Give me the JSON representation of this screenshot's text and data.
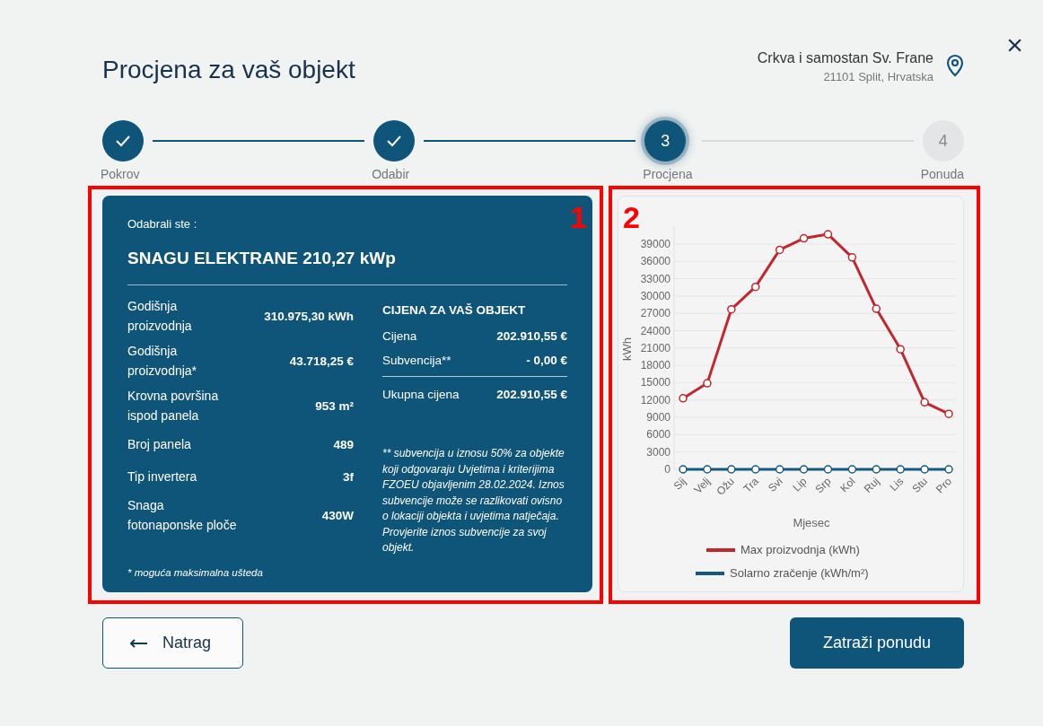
{
  "header": {
    "title": "Procjena za vaš objekt",
    "location_name": "Crkva i samostan Sv. Frane",
    "location_address": "21101 Split, Hrvatska",
    "close": "×"
  },
  "steps": [
    {
      "label": "Pokrov",
      "completed": true,
      "selected": false
    },
    {
      "label": "Odabir",
      "completed": true,
      "selected": false
    },
    {
      "label": "Procjena",
      "number": "3",
      "completed": false,
      "selected": true
    },
    {
      "label": "Ponuda",
      "number": "4",
      "completed": false,
      "selected": false
    }
  ],
  "summary": {
    "intro": "Odabrali ste :",
    "headline": "SNAGU ELEKTRANE 210,27 kWp",
    "specs": [
      {
        "label": "Godišnja proizvodnja",
        "value": "310.975,30 kWh"
      },
      {
        "label": "Godišnja proizvodnja*",
        "value": "43.718,25 €"
      },
      {
        "label": "Krovna površina ispod panela",
        "value": "953 m²"
      },
      {
        "label": "Broj panela",
        "value": "489"
      },
      {
        "label": "Tip invertera",
        "value": "3f"
      },
      {
        "label": "Snaga fotonaponske ploče",
        "value": "430W"
      }
    ],
    "footnote": "* moguća maksimalna ušteda",
    "price": {
      "title": "CIJENA ZA VAŠ OBJEKT",
      "rows": [
        {
          "kind": "item",
          "label": "Cijena",
          "value": "202.910,55 €"
        },
        {
          "kind": "item",
          "label": "Subvencija**",
          "value": "- 0,00 €"
        },
        {
          "kind": "total",
          "label": "Ukupna cijena",
          "value": "202.910,55 €"
        }
      ],
      "note": "** subvencija u iznosu 50% za objekte koji odgovaraju Uvjetima i kriterijima FZOEU objavljenim 28.02.2024. Iznos subvencije može se razlikovati ovisno o lokaciji objekta i uvjetima natječaja. Provjerite iznos subvencije za svoj objekt."
    }
  },
  "chart_data": {
    "type": "line",
    "xlabel": "Mjesec",
    "ylabel": "kWh",
    "categories": [
      "Sij",
      "Velj",
      "Ožu",
      "Tra",
      "Svi",
      "Lip",
      "Srp",
      "Kol",
      "Ruj",
      "Lis",
      "Stu",
      "Pro"
    ],
    "ylim": [
      0,
      42000
    ],
    "grid": true,
    "legend": true,
    "series": [
      {
        "name": "Max proizvodnja (kWh)",
        "color": "#c0282d",
        "marker": "circle",
        "values": [
          12300,
          14900,
          27700,
          31600,
          38000,
          40000,
          40700,
          36700,
          27800,
          20800,
          11600,
          9600
        ]
      },
      {
        "name": "Solarno zračenje (kWh/m²)",
        "color": "#145a80",
        "marker": "circle",
        "values": [
          0,
          0,
          0,
          0,
          0,
          0,
          0,
          0,
          0,
          0,
          0,
          0
        ]
      }
    ],
    "yticks": [
      0,
      3000,
      6000,
      9000,
      12000,
      15000,
      18000,
      21000,
      24000,
      27000,
      30000,
      33000,
      36000,
      39000
    ]
  },
  "annotations": [
    {
      "label": "1"
    },
    {
      "label": "2"
    }
  ],
  "buttons": {
    "back": "Natrag",
    "submit": "Zatraži ponudu"
  }
}
